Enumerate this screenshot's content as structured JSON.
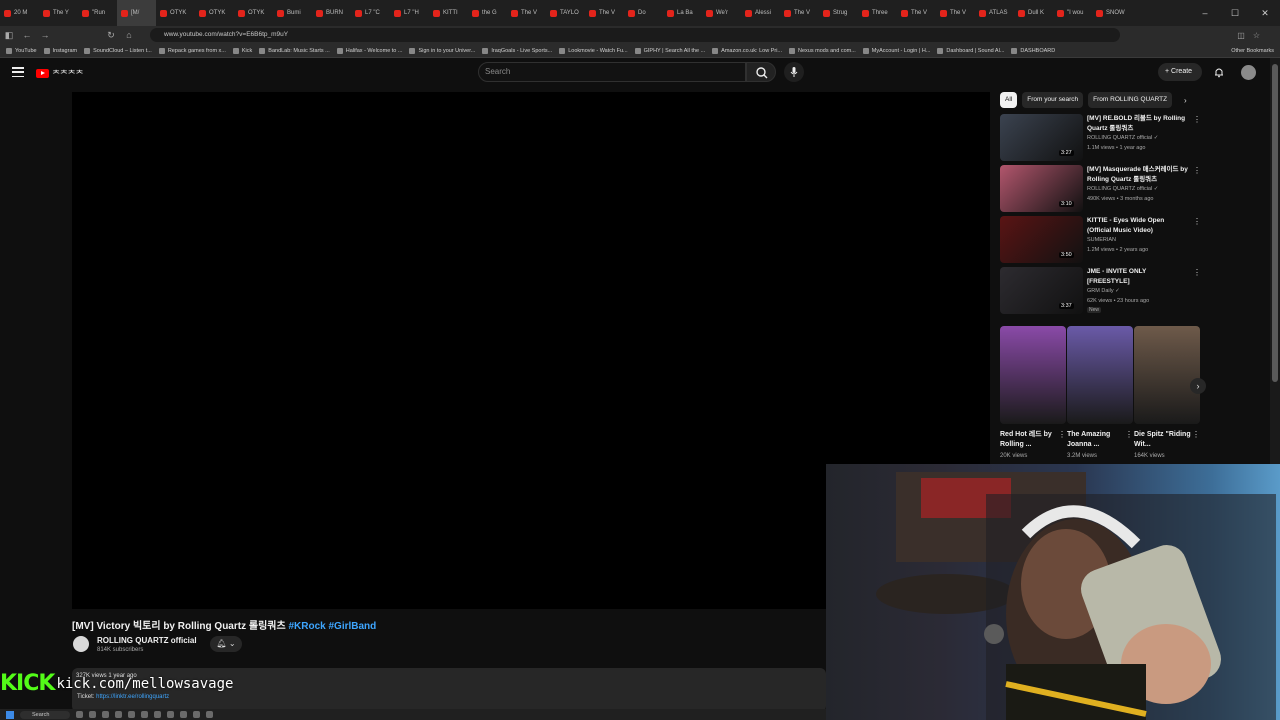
{
  "browser": {
    "tabs": [
      {
        "label": "20 M",
        "active": false
      },
      {
        "label": "The Y",
        "active": false
      },
      {
        "label": "\"Run",
        "active": false
      },
      {
        "label": "[M/",
        "active": true
      },
      {
        "label": "OTYK",
        "active": false
      },
      {
        "label": "OTYK",
        "active": false
      },
      {
        "label": "OTYK",
        "active": false
      },
      {
        "label": "Bumi",
        "active": false
      },
      {
        "label": "BURN",
        "active": false
      },
      {
        "label": "L7 \"C",
        "active": false
      },
      {
        "label": "L7 \"H",
        "active": false
      },
      {
        "label": "KITTI",
        "active": false
      },
      {
        "label": "the G",
        "active": false
      },
      {
        "label": "The V",
        "active": false
      },
      {
        "label": "TAYLO",
        "active": false
      },
      {
        "label": "The V",
        "active": false
      },
      {
        "label": "Do",
        "active": false
      },
      {
        "label": "La Ba",
        "active": false
      },
      {
        "label": "We'r",
        "active": false
      },
      {
        "label": "Alessi",
        "active": false
      },
      {
        "label": "The V",
        "active": false
      },
      {
        "label": "Strug",
        "active": false
      },
      {
        "label": "Three",
        "active": false
      },
      {
        "label": "The V",
        "active": false
      },
      {
        "label": "The V",
        "active": false
      },
      {
        "label": "ATLAS",
        "active": false
      },
      {
        "label": "Dull K",
        "active": false
      },
      {
        "label": "\"I wou",
        "active": false
      },
      {
        "label": "SNOW",
        "active": false
      }
    ],
    "url": "www.youtube.com/watch?v=E6B6tp_m9uY",
    "bookmarks": [
      "YouTube",
      "Instagram",
      "SoundCloud – Listen t...",
      "Repack games from x...",
      "Kick",
      "BandLab: Music Starts ...",
      "Halifax - Welcome to ...",
      "Sign in to your Univer...",
      "IraqGoals - Live Sports...",
      "Lookmovie - Watch Fu...",
      "GIPHY | Search All the ...",
      "Amazon.co.uk: Low Pri...",
      "Nexus mods and com...",
      "MyAccount - Login | H...",
      "Dashboard | Sound Al...",
      "DASHBOARD"
    ],
    "other_bookmarks": "Other Bookmarks"
  },
  "youtube": {
    "logo_text": "ᄎᄎᄎᄎ",
    "search_placeholder": "Search",
    "create_label": "Create"
  },
  "video": {
    "title": "[MV] Victory 빅토리 by Rolling Quartz 롤링쿼츠",
    "hashtags": "#KRock #GirlBand",
    "channel": "ROLLING QUARTZ official",
    "subscribers": "814K subscribers",
    "views": "327K views  1 year ago",
    "ticket_label": "Ticket:",
    "ticket_link": "https://linktr.ee/rollingquartz"
  },
  "chips": [
    {
      "label": "All",
      "active": true
    },
    {
      "label": "From your search",
      "active": false
    },
    {
      "label": "From ROLLING QUARTZ",
      "active": false
    }
  ],
  "recommendations": [
    {
      "title": "[MV] RE.BOLD 리볼드 by Rolling Quartz 롤링쿼츠",
      "channel": "ROLLING QUARTZ official ✓",
      "meta": "1.1M views • 1 year ago",
      "duration": "3:27",
      "color": "#3b4350",
      "new": ""
    },
    {
      "title": "[MV] Masquerade 매스커레이드 by Rolling Quartz 롤링쿼츠",
      "channel": "ROLLING QUARTZ official ✓",
      "meta": "490K views • 3 months ago",
      "duration": "3:10",
      "color": "#b2566d",
      "new": ""
    },
    {
      "title": "KITTIE - Eyes Wide Open (Official Music Video)",
      "channel": "SUMERIAN",
      "meta": "1.2M views • 2 years ago",
      "duration": "3:50",
      "color": "#5a1414",
      "new": ""
    },
    {
      "title": "JME - INVITE ONLY [FREESTYLE]",
      "channel": "GRM Daily ✓",
      "meta": "62K views • 23 hours ago",
      "duration": "3:37",
      "color": "#2d2b30",
      "new": "New"
    }
  ],
  "shorts": [
    {
      "title": "Red Hot 레드 by Rolling ...",
      "views": "20K views",
      "color": "#8a4aa8"
    },
    {
      "title": "The Amazing Joanna ...",
      "views": "3.2M views",
      "color": "#6a5aa8"
    },
    {
      "title": "Die Spitz \"Riding Wit...",
      "views": "164K views",
      "color": "#6e5a4a"
    }
  ],
  "overlay": {
    "kick_logo": "KICK",
    "kick_url": "kick.com/mellowsavage"
  },
  "taskbar": {
    "search_label": "Search"
  }
}
